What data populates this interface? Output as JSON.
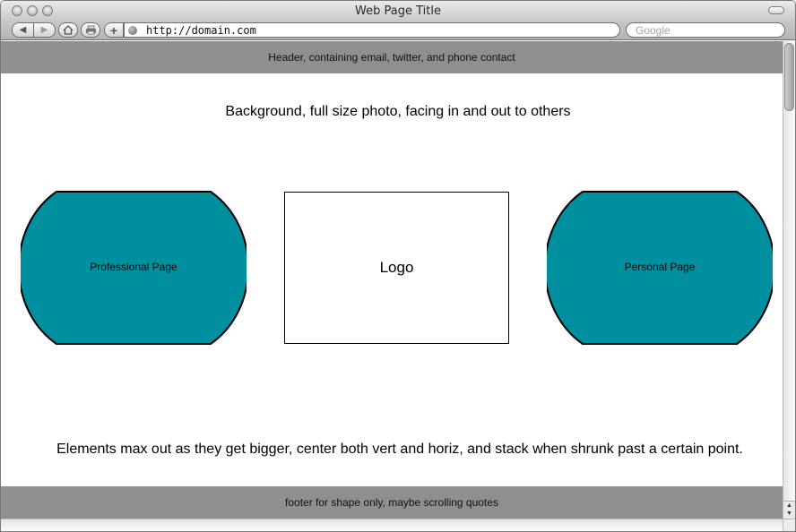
{
  "window": {
    "title": "Web Page Title"
  },
  "toolbar": {
    "back_icon": "back-arrow-icon",
    "forward_icon": "forward-arrow-icon",
    "home_icon": "home-icon",
    "print_icon": "print-icon",
    "add_icon": "plus-icon",
    "url": "http://domain.com",
    "search_placeholder": "Google"
  },
  "page": {
    "header_text": "Header, containing email, twitter, and phone contact",
    "background_note": "Background, full size photo, facing in and out to others",
    "professional_label": "Professional Page",
    "logo_label": "Logo",
    "personal_label": "Personal Page",
    "elements_note": "Elements max out as they get bigger, center both vert and horiz, and stack when shrunk past a certain point.",
    "footer_text": "footer for shape only, maybe scrolling quotes"
  },
  "colors": {
    "band_gray": "#8f8f8f",
    "teal": "#008f9f"
  }
}
